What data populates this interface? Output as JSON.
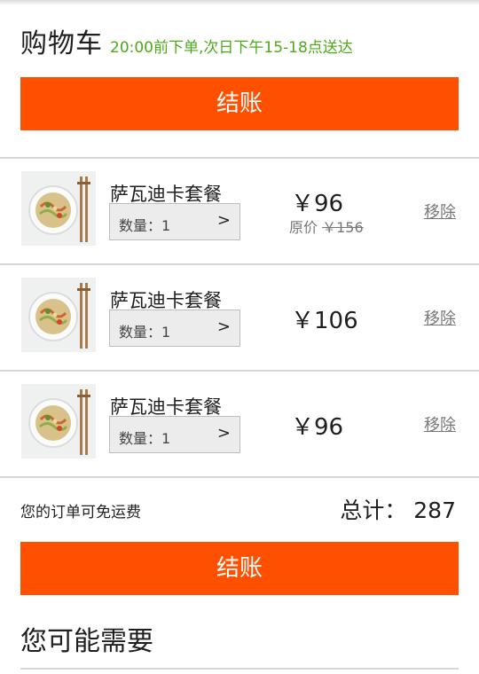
{
  "header": {
    "title": "购物车",
    "delivery_note": "20:00前下单,次日下午15-18点送达"
  },
  "checkout": {
    "label": "结账"
  },
  "cart": {
    "items": [
      {
        "name": "萨瓦迪卡套餐",
        "quantity_label": "数量：1",
        "price": "￥96",
        "original_prefix": "原价",
        "original_price": "￥156",
        "remove_label": "移除"
      },
      {
        "name": "萨瓦迪卡套餐",
        "quantity_label": "数量：1",
        "price": "￥106",
        "remove_label": "移除"
      },
      {
        "name": "萨瓦迪卡套餐",
        "quantity_label": "数量：1",
        "price": "￥96",
        "remove_label": "移除"
      }
    ],
    "quantity_chevron": ">",
    "item_icon": "noodle-bowl-chopsticks-icon"
  },
  "summary": {
    "free_shipping": "您的订单可免运费",
    "total": "总计：  287"
  },
  "suggestions": {
    "title": "您可能需要"
  },
  "colors": {
    "accent": "#ff5000",
    "note_green": "#4caa18",
    "divider": "#d7d7d7"
  }
}
